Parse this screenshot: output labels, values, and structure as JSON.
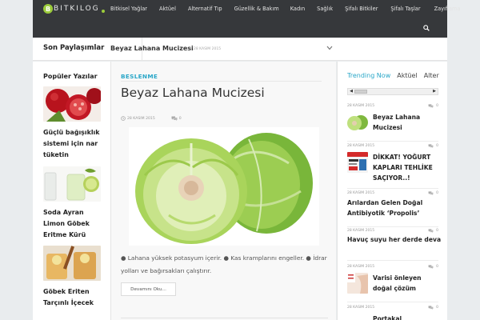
{
  "logo": {
    "text": "BITKILOG"
  },
  "nav": {
    "items": [
      "Bitkisel Yağlar",
      "Aktüel",
      "Alternatif Tıp",
      "Güzellik & Bakım",
      "Kadın",
      "Sağlık",
      "Şifalı Bitkiler",
      "Şifalı Taşlar",
      "Zayıflama"
    ],
    "search_icon": "search-icon"
  },
  "ticker": {
    "label": "Son Paylaşımlar",
    "title": "Beyaz Lahana Mucizesi",
    "date": "28 KASIM 2015"
  },
  "left_sidebar": {
    "heading": "Popüler Yazılar",
    "posts": [
      {
        "title": "Güçlü bağışıklık sistemi için nar tüketin"
      },
      {
        "title": "Soda Ayran Limon Göbek Eritme Kürü"
      },
      {
        "title": "Göbek Eriten Tarçınlı İçecek"
      }
    ]
  },
  "article": {
    "category": "BESLENME",
    "title": "Beyaz Lahana Mucizesi",
    "date": "28 KASIM 2015",
    "comments": "0",
    "excerpt": "● Lahana yüksek potasyum içerir. ● Kas kramplarını engeller. ● İdrar yolları ve bağırsakları çalıştırır.",
    "read_more": "Devamını Oku..."
  },
  "right_sidebar": {
    "tabs": [
      "Trending Now",
      "Aktüel",
      "Alter"
    ],
    "items": [
      {
        "date": "28 KASIM 2015",
        "comments": "0",
        "title": "Beyaz Lahana Mucizesi"
      },
      {
        "date": "28 KASIM 2015",
        "comments": "0",
        "title": "DİKKAT! YOĞURT KAPLARI TEHLİKE SAÇIYOR..!"
      },
      {
        "date": "28 KASIM 2015",
        "comments": "0",
        "title": "Arılardan Gelen Doğal Antibiyotik ‘Propolis’"
      },
      {
        "date": "28 KASIM 2015",
        "comments": "0",
        "title": "Havuç suyu her derde deva"
      },
      {
        "date": "28 KASIM 2015",
        "comments": "0",
        "title": "Varisi önleyen doğal çözüm"
      },
      {
        "date": "28 KASIM 2015",
        "comments": "0",
        "title": "Portakal"
      }
    ]
  },
  "colors": {
    "accent": "#2aa7c8",
    "nav_bg": "#36383b",
    "logo_green": "#9ccc3b"
  }
}
